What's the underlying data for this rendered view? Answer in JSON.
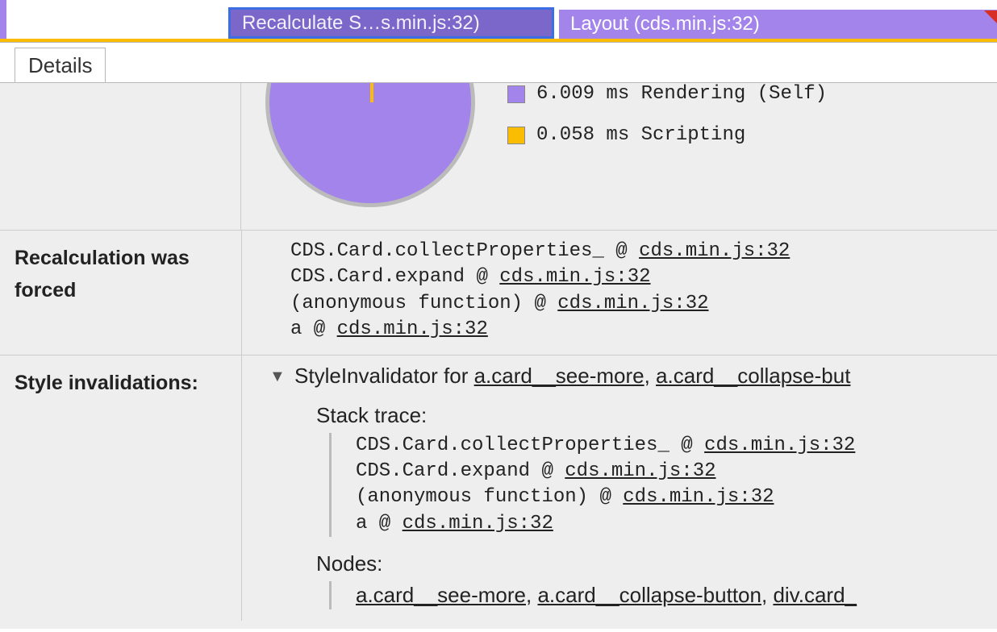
{
  "flame": {
    "recalc_label": "Recalculate S…s.min.js:32)",
    "layout_label": "Layout (cds.min.js:32)"
  },
  "tabs": {
    "details": "Details"
  },
  "chart_data": {
    "type": "pie",
    "series": [
      {
        "name": "Rendering (Self)",
        "value": 6.009,
        "unit": "ms",
        "color": "#a284eb"
      },
      {
        "name": "Scripting",
        "value": 0.058,
        "unit": "ms",
        "color": "#fbbc04"
      }
    ]
  },
  "legend": {
    "render": "6.009 ms Rendering (Self)",
    "script": "0.058 ms Scripting"
  },
  "recalc": {
    "label": "Recalculation was forced",
    "stack": [
      {
        "fn": "CDS.Card.collectProperties_",
        "at": " @ ",
        "loc": "cds.min.js:32"
      },
      {
        "fn": "CDS.Card.expand",
        "at": " @ ",
        "loc": "cds.min.js:32"
      },
      {
        "fn": "(anonymous function)",
        "at": " @ ",
        "loc": "cds.min.js:32"
      },
      {
        "fn": "a",
        "at": " @ ",
        "loc": "cds.min.js:32"
      }
    ]
  },
  "inval": {
    "label": "Style invalidations:",
    "head_prefix": "StyleInvalidator for ",
    "head_sel1": "a.card__see-more",
    "head_sep": ", ",
    "head_sel2": "a.card__collapse-but",
    "stack_label": "Stack trace:",
    "stack": [
      {
        "fn": "CDS.Card.collectProperties_",
        "at": " @ ",
        "loc": "cds.min.js:32"
      },
      {
        "fn": "CDS.Card.expand",
        "at": " @ ",
        "loc": "cds.min.js:32"
      },
      {
        "fn": "(anonymous function)",
        "at": " @ ",
        "loc": "cds.min.js:32"
      },
      {
        "fn": "a",
        "at": " @ ",
        "loc": "cds.min.js:32"
      }
    ],
    "nodes_label": "Nodes:",
    "nodes": [
      "a.card__see-more",
      "a.card__collapse-button",
      "div.card_"
    ],
    "nodes_sep": ", "
  }
}
